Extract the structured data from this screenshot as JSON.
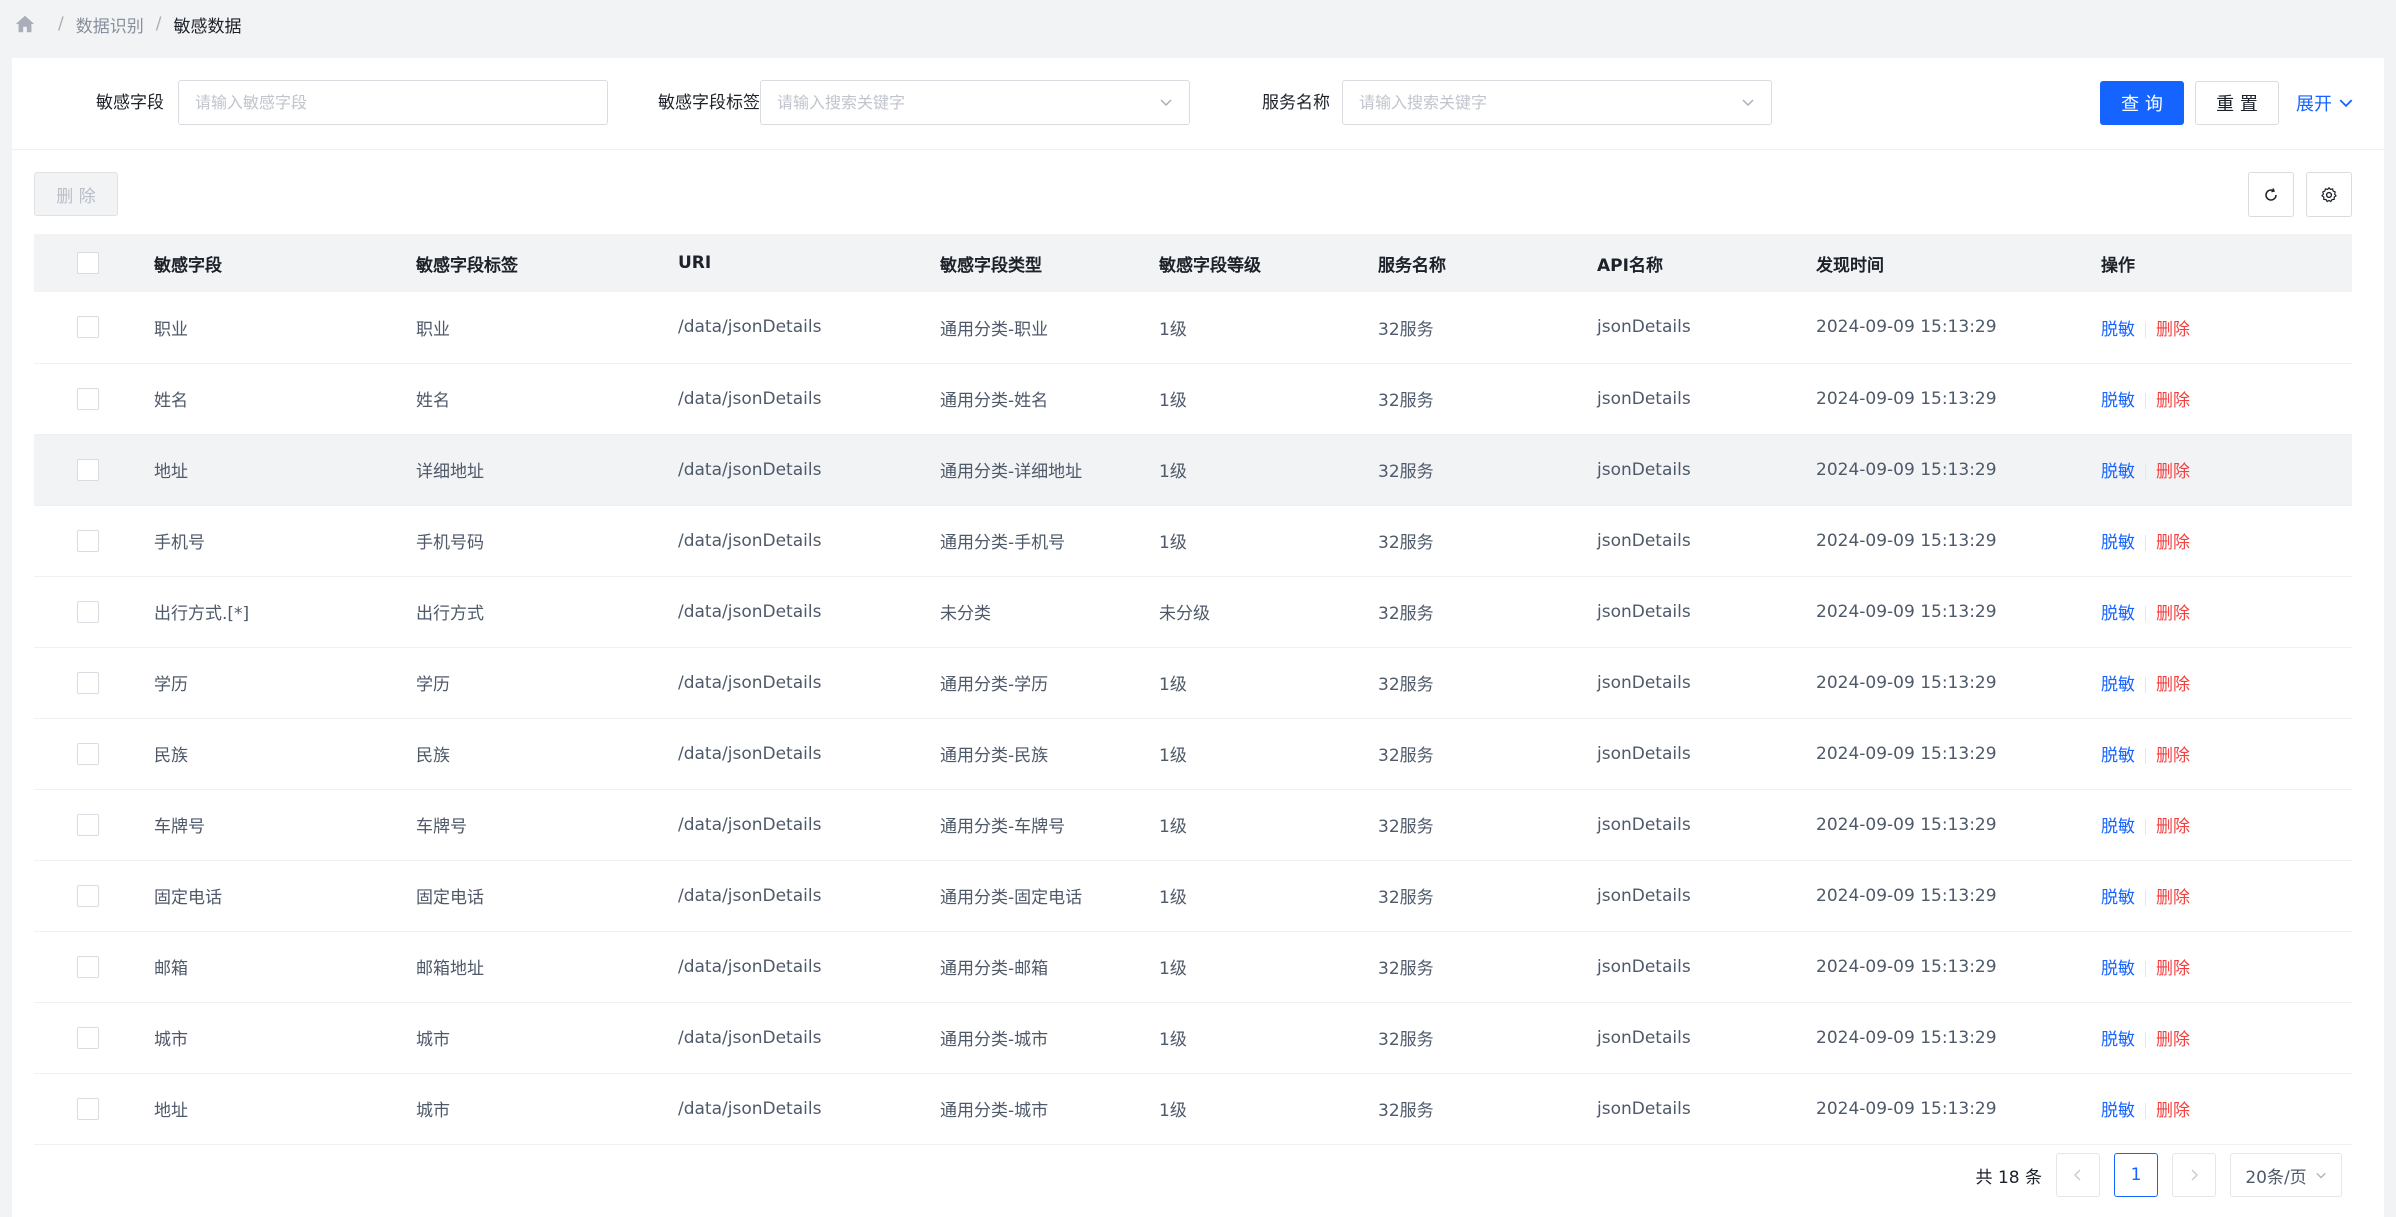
{
  "breadcrumb": {
    "items": [
      "数据识别",
      "敏感数据"
    ]
  },
  "filters": {
    "field": {
      "label": "敏感字段",
      "placeholder": "请输入敏感字段"
    },
    "tag": {
      "label": "敏感字段标签",
      "placeholder": "请输入搜索关键字"
    },
    "service": {
      "label": "服务名称",
      "placeholder": "请输入搜索关键字"
    },
    "query_label": "查 询",
    "reset_label": "重 置",
    "expand_label": "展开"
  },
  "toolbar": {
    "delete_label": "删 除"
  },
  "table": {
    "columns": [
      "敏感字段",
      "敏感字段标签",
      "URI",
      "敏感字段类型",
      "敏感字段等级",
      "服务名称",
      "API名称",
      "发现时间",
      "操作"
    ],
    "rows": [
      {
        "field": "职业",
        "tag": "职业",
        "uri": "/data/jsonDetails",
        "type": "通用分类-职业",
        "level": "1级",
        "service": "32服务",
        "api": "jsonDetails",
        "time": "2024-09-09 15:13:29",
        "op1": "脱敏",
        "op2": "删除"
      },
      {
        "field": "姓名",
        "tag": "姓名",
        "uri": "/data/jsonDetails",
        "type": "通用分类-姓名",
        "level": "1级",
        "service": "32服务",
        "api": "jsonDetails",
        "time": "2024-09-09 15:13:29",
        "op1": "脱敏",
        "op2": "删除"
      },
      {
        "field": "地址",
        "tag": "详细地址",
        "uri": "/data/jsonDetails",
        "type": "通用分类-详细地址",
        "level": "1级",
        "service": "32服务",
        "api": "jsonDetails",
        "time": "2024-09-09 15:13:29",
        "op1": "脱敏",
        "op2": "删除"
      },
      {
        "field": "手机号",
        "tag": "手机号码",
        "uri": "/data/jsonDetails",
        "type": "通用分类-手机号",
        "level": "1级",
        "service": "32服务",
        "api": "jsonDetails",
        "time": "2024-09-09 15:13:29",
        "op1": "脱敏",
        "op2": "删除"
      },
      {
        "field": "出行方式.[*]",
        "tag": "出行方式",
        "uri": "/data/jsonDetails",
        "type": "未分类",
        "level": "未分级",
        "service": "32服务",
        "api": "jsonDetails",
        "time": "2024-09-09 15:13:29",
        "op1": "脱敏",
        "op2": "删除"
      },
      {
        "field": "学历",
        "tag": "学历",
        "uri": "/data/jsonDetails",
        "type": "通用分类-学历",
        "level": "1级",
        "service": "32服务",
        "api": "jsonDetails",
        "time": "2024-09-09 15:13:29",
        "op1": "脱敏",
        "op2": "删除"
      },
      {
        "field": "民族",
        "tag": "民族",
        "uri": "/data/jsonDetails",
        "type": "通用分类-民族",
        "level": "1级",
        "service": "32服务",
        "api": "jsonDetails",
        "time": "2024-09-09 15:13:29",
        "op1": "脱敏",
        "op2": "删除"
      },
      {
        "field": "车牌号",
        "tag": "车牌号",
        "uri": "/data/jsonDetails",
        "type": "通用分类-车牌号",
        "level": "1级",
        "service": "32服务",
        "api": "jsonDetails",
        "time": "2024-09-09 15:13:29",
        "op1": "脱敏",
        "op2": "删除"
      },
      {
        "field": "固定电话",
        "tag": "固定电话",
        "uri": "/data/jsonDetails",
        "type": "通用分类-固定电话",
        "level": "1级",
        "service": "32服务",
        "api": "jsonDetails",
        "time": "2024-09-09 15:13:29",
        "op1": "脱敏",
        "op2": "删除"
      },
      {
        "field": "邮箱",
        "tag": "邮箱地址",
        "uri": "/data/jsonDetails",
        "type": "通用分类-邮箱",
        "level": "1级",
        "service": "32服务",
        "api": "jsonDetails",
        "time": "2024-09-09 15:13:29",
        "op1": "脱敏",
        "op2": "删除"
      },
      {
        "field": "城市",
        "tag": "城市",
        "uri": "/data/jsonDetails",
        "type": "通用分类-城市",
        "level": "1级",
        "service": "32服务",
        "api": "jsonDetails",
        "time": "2024-09-09 15:13:29",
        "op1": "脱敏",
        "op2": "删除"
      },
      {
        "field": "地址",
        "tag": "城市",
        "uri": "/data/jsonDetails",
        "type": "通用分类-城市",
        "level": "1级",
        "service": "32服务",
        "api": "jsonDetails",
        "time": "2024-09-09 15:13:29",
        "op1": "脱敏",
        "op2": "删除"
      }
    ]
  },
  "pagination": {
    "total_label": "共 18 条",
    "current_page": "1",
    "page_size_label": "20条/页"
  },
  "colors": {
    "primary": "#1664ff",
    "danger": "#f53f3f"
  },
  "icons": {
    "home": "home-icon",
    "refresh": "refresh-icon",
    "settings": "gear-icon",
    "expand": "chevron-down-icon"
  }
}
